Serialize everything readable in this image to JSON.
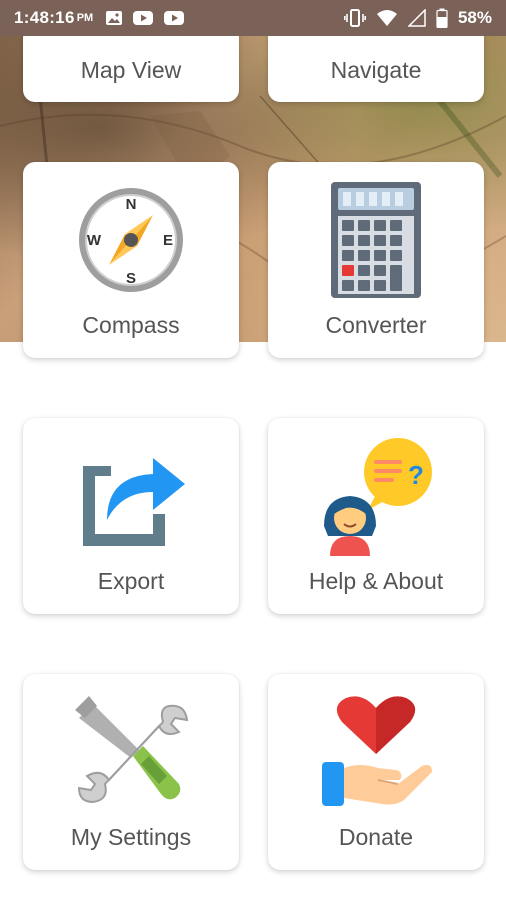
{
  "status_bar": {
    "time": "1:48:16",
    "ampm": "PM",
    "battery_percent": "58%",
    "icons_left": [
      "image-icon",
      "youtube-icon",
      "youtube-icon"
    ],
    "icons_right": [
      "vibrate-icon",
      "wifi-icon",
      "signal-icon",
      "battery-icon"
    ]
  },
  "menu": {
    "map_view": "Map View",
    "navigate": "Navigate",
    "compass": "Compass",
    "converter": "Converter",
    "export": "Export",
    "help_about": "Help & About",
    "my_settings": "My Settings",
    "donate": "Donate"
  },
  "colors": {
    "status_bar_bg": "#7a6258",
    "card_bg": "#ffffff",
    "label_text": "#555555"
  }
}
